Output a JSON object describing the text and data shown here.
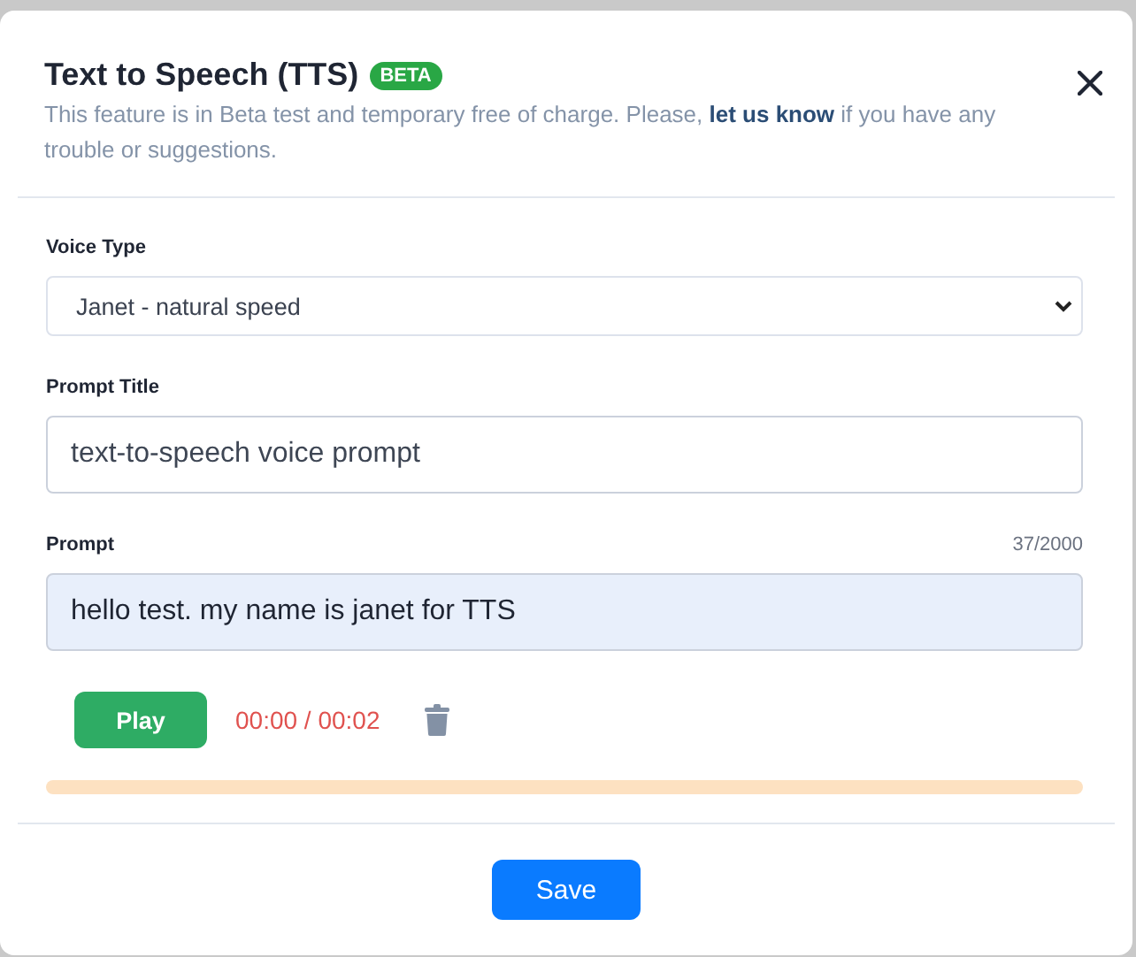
{
  "dialog": {
    "title": "Text to Speech (TTS)",
    "badge": "BETA",
    "description": "This feature is in Beta test and temporary free of charge. Please, ",
    "link": "let us know",
    "description_end": " if you have any trouble or suggestions."
  },
  "fields": [
    {
      "kind": "select",
      "label": "Voice Type",
      "value": "Janet - natural speed"
    },
    {
      "kind": "input",
      "label": "Prompt Title",
      "value": "text-to-speech voice prompt"
    },
    {
      "kind": "prompt",
      "label": "Prompt",
      "counter": "37/2000",
      "value": "hello test. my name is janet for TTS"
    }
  ],
  "player": {
    "button": "Play",
    "time": "00:00 / 00:02",
    "progress": {
      "level": 0
    }
  },
  "footer": {
    "button": "Save"
  }
}
